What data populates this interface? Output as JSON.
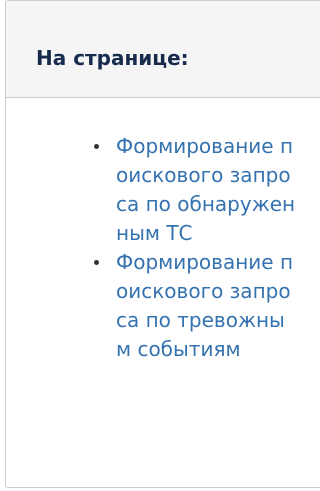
{
  "panel": {
    "title": "На странице:"
  },
  "toc": {
    "items": [
      {
        "label": "Формирование поискового запроса по обнаруженным ТС"
      },
      {
        "label": "Формирование поискового запроса по тревожным событиям"
      }
    ]
  },
  "colors": {
    "link": "#3572b0",
    "header_bg": "#f5f5f5",
    "border": "#cccccc",
    "title": "#172b4d"
  }
}
